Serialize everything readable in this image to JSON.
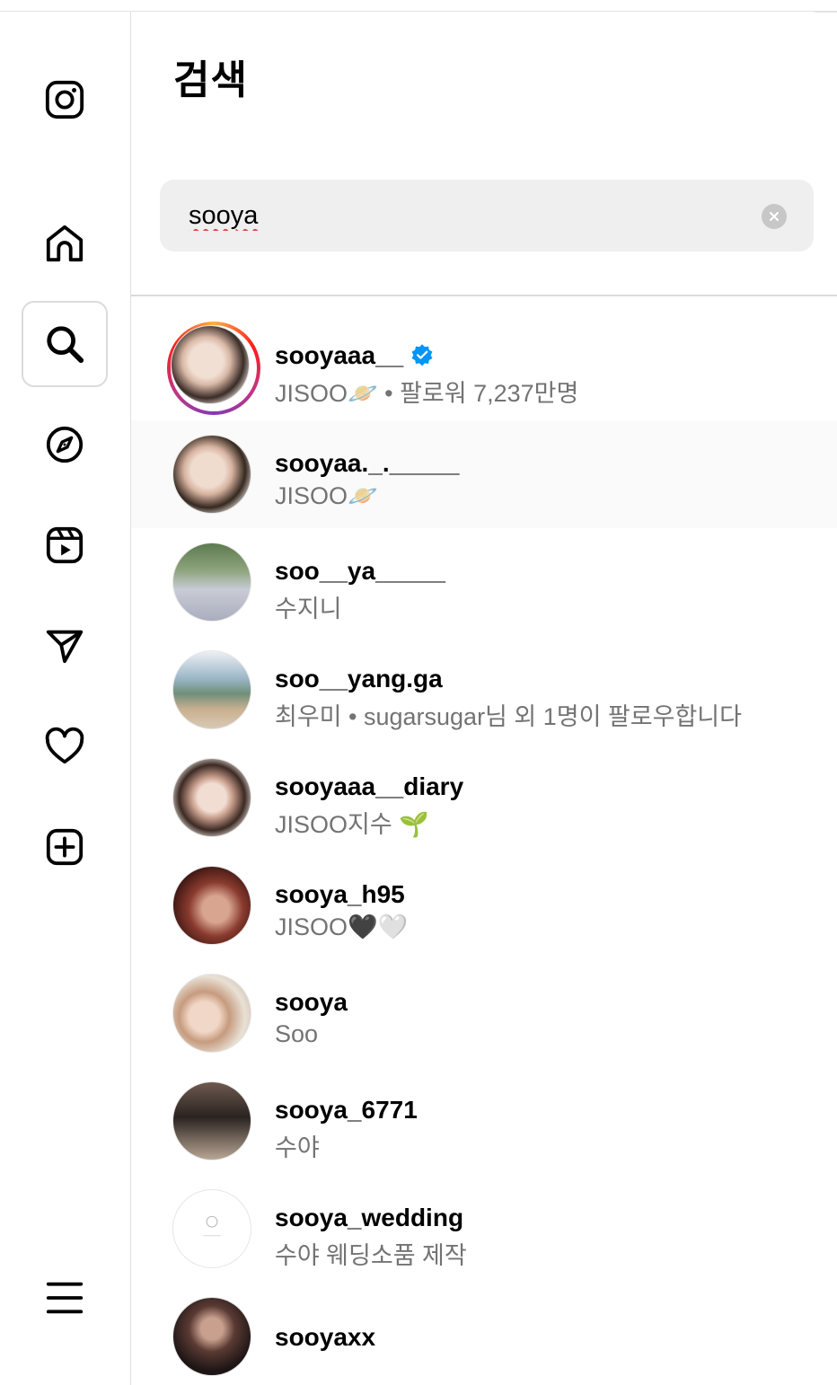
{
  "header": {
    "title": "검색"
  },
  "search": {
    "value": "sooya"
  },
  "results": [
    {
      "username": "sooyaaa__",
      "verified": true,
      "subtitle": "JISOO🪐 • 팔로워 7,237만명",
      "story": true
    },
    {
      "username": "sooyaa._._____",
      "subtitle": "JISOO🪐"
    },
    {
      "username": "soo__ya_____",
      "subtitle": "수지니"
    },
    {
      "username": "soo__yang.ga",
      "subtitle": "최우미 • sugarsugar님 외 1명이 팔로우합니다"
    },
    {
      "username": "sooyaaa__diary",
      "subtitle": "JISOO지수 🌱"
    },
    {
      "username": "sooya_h95",
      "subtitle": "JISOO🖤🤍"
    },
    {
      "username": "sooya",
      "subtitle": "Soo"
    },
    {
      "username": "sooya_6771",
      "subtitle": "수야"
    },
    {
      "username": "sooya_wedding",
      "subtitle": "수야 웨딩소품 제작"
    },
    {
      "username": "sooyaxx",
      "subtitle": ""
    }
  ],
  "icons": {
    "nav": [
      "instagram-logo-icon",
      "home-icon",
      "search-icon",
      "compass-icon",
      "reels-icon",
      "send-icon",
      "heart-icon",
      "create-icon",
      "menu-icon"
    ]
  },
  "colors": {
    "accent": "#0095f6",
    "verified": "#0095f6",
    "muted": "#737373",
    "search_bg": "#efefef"
  }
}
